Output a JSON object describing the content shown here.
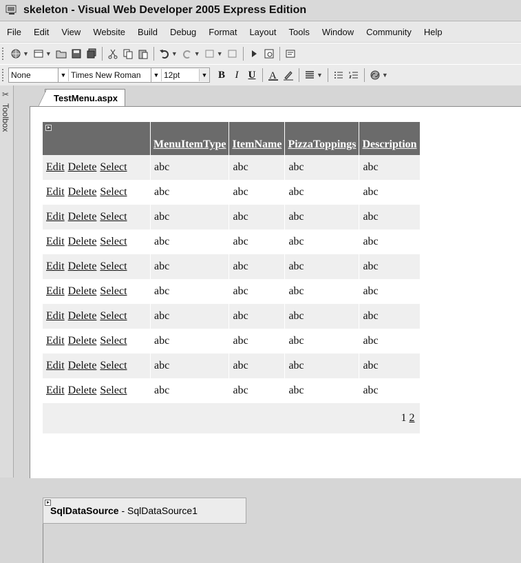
{
  "window": {
    "title": "skeleton - Visual Web Developer 2005 Express Edition"
  },
  "menu": [
    "File",
    "Edit",
    "View",
    "Website",
    "Build",
    "Debug",
    "Format",
    "Layout",
    "Tools",
    "Window",
    "Community",
    "Help"
  ],
  "format_toolbar": {
    "block_format": "None",
    "font_name": "Times New Roman",
    "font_size": "12pt",
    "bold": "B",
    "italic": "I",
    "underline": "U"
  },
  "toolbox_label": "Toolbox",
  "tab": {
    "label": "TestMenu.aspx"
  },
  "grid": {
    "columns": [
      "MenuItemType",
      "ItemName",
      "PizzaToppings",
      "Description"
    ],
    "action_links": [
      "Edit",
      "Delete",
      "Select"
    ],
    "rows": [
      [
        "abc",
        "abc",
        "abc",
        "abc"
      ],
      [
        "abc",
        "abc",
        "abc",
        "abc"
      ],
      [
        "abc",
        "abc",
        "abc",
        "abc"
      ],
      [
        "abc",
        "abc",
        "abc",
        "abc"
      ],
      [
        "abc",
        "abc",
        "abc",
        "abc"
      ],
      [
        "abc",
        "abc",
        "abc",
        "abc"
      ],
      [
        "abc",
        "abc",
        "abc",
        "abc"
      ],
      [
        "abc",
        "abc",
        "abc",
        "abc"
      ],
      [
        "abc",
        "abc",
        "abc",
        "abc"
      ],
      [
        "abc",
        "abc",
        "abc",
        "abc"
      ]
    ],
    "pager": [
      "1",
      "2"
    ]
  },
  "datasource": {
    "type": "SqlDataSource",
    "separator": " - ",
    "name": "SqlDataSource1"
  }
}
